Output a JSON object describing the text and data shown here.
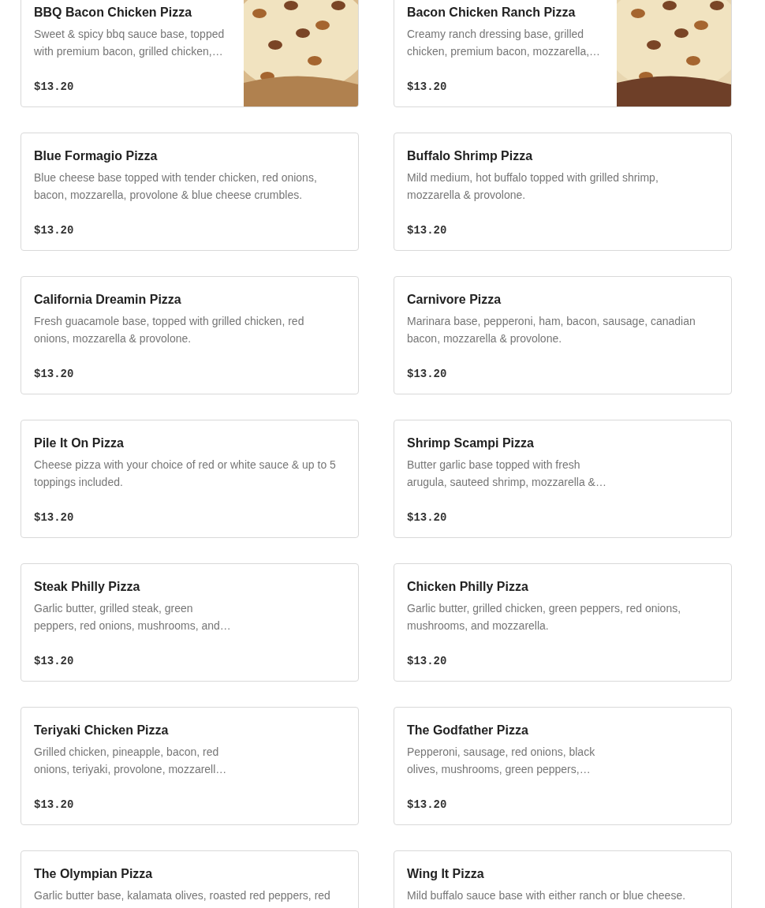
{
  "menu_items": [
    {
      "name": "BBQ Bacon Chicken Pizza",
      "description_lines": [
        "Sweet & spicy bbq sauce base, topped",
        "with premium bacon, grilled chicken,…"
      ],
      "price": "$13.20"
    },
    {
      "name": "Bacon Chicken Ranch Pizza",
      "description_lines": [
        "Creamy ranch dressing base, grilled",
        "chicken, premium bacon, mozzarella,…"
      ],
      "price": "$13.20"
    },
    {
      "kind": "plain",
      "name": "Blue Formagio Pizza",
      "description_lines": [
        "Blue cheese base topped with tender chicken, red onions,",
        "bacon, mozzarella, provolone & blue cheese crumbles."
      ],
      "price": "$13.20"
    },
    {
      "kind": "plain",
      "name": "Buffalo Shrimp Pizza",
      "description_lines": [
        "Mild medium, hot buffalo topped with grilled shrimp,",
        "mozzarella & provolone."
      ],
      "price": "$13.20"
    },
    {
      "kind": "plain",
      "name": "California Dreamin Pizza",
      "description_lines": [
        "Fresh guacamole base, topped with grilled chicken, red",
        "onions, mozzarella & provolone."
      ],
      "price": "$13.20"
    },
    {
      "kind": "plain",
      "name": "Carnivore Pizza",
      "description_lines": [
        "Marinara base, pepperoni, ham, bacon, sausage, canadian",
        "bacon, mozzarella & provolone."
      ],
      "price": "$13.20"
    },
    {
      "kind": "plain",
      "name": "Pile It On Pizza",
      "description_lines": [
        "Cheese pizza with your choice of red or white sauce & up to 5",
        "toppings included."
      ],
      "price": "$13.20"
    },
    {
      "kind": "plain",
      "name": "Shrimp Scampi Pizza",
      "description_lines": [
        "Butter garlic base topped with fresh",
        "arugula, sauteed shrimp, mozzarella &…"
      ],
      "price": "$13.20"
    },
    {
      "kind": "plain",
      "name": "Steak Philly Pizza",
      "description_lines": [
        "Garlic butter, grilled steak, green",
        "peppers, red onions, mushrooms, and…"
      ],
      "price": "$13.20"
    },
    {
      "kind": "plain",
      "name": "Chicken Philly Pizza",
      "description_lines": [
        "Garlic butter, grilled chicken, green peppers, red onions,",
        "mushrooms, and mozzarella."
      ],
      "price": "$13.20"
    },
    {
      "kind": "plain",
      "name": "Teriyaki Chicken Pizza",
      "description_lines": [
        "Grilled chicken, pineapple, bacon, red",
        "onions, teriyaki, provolone, mozzarell…"
      ],
      "price": "$13.20"
    },
    {
      "kind": "plain",
      "name": "The Godfather Pizza",
      "description_lines": [
        "Pepperoni, sausage, red onions, black",
        "olives, mushrooms, green peppers,…"
      ],
      "price": "$13.20"
    },
    {
      "kind": "plain",
      "name": "The Olympian Pizza",
      "description_lines": [
        "Garlic butter base, kalamata olives, roasted red peppers, red"
      ]
    },
    {
      "kind": "plain",
      "name": "Wing It Pizza",
      "description_lines": [
        "Mild buffalo sauce base with either ranch or blue cheese."
      ]
    }
  ]
}
